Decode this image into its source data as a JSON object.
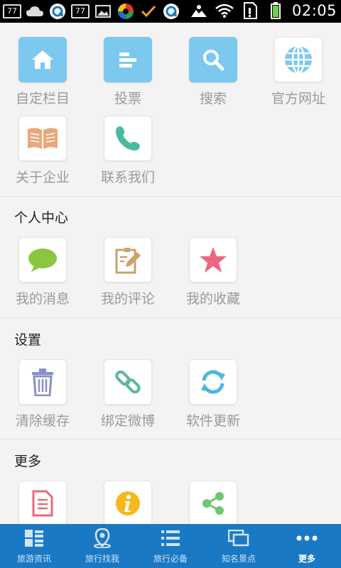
{
  "status_bar": {
    "left_badge_1": "77",
    "left_badge_2": "77",
    "time": "02:05",
    "icons": [
      "notification-number-icon",
      "cloud-icon",
      "q-app-icon",
      "notification-number-icon",
      "image-icon",
      "sync-app-icon",
      "checkmark-icon",
      "q-app-icon",
      "photo-icon",
      "wifi-icon",
      "sim-icon",
      "battery-icon"
    ]
  },
  "top_grid": [
    {
      "label": "自定栏目",
      "icon": "home-icon"
    },
    {
      "label": "投票",
      "icon": "bar-list-icon"
    },
    {
      "label": "搜索",
      "icon": "search-icon"
    },
    {
      "label": "官方网址",
      "icon": "globe-icon"
    },
    {
      "label": "关于企业",
      "icon": "book-icon"
    },
    {
      "label": "联系我们",
      "icon": "phone-icon"
    }
  ],
  "sections": {
    "personal": {
      "title": "个人中心",
      "items": [
        {
          "label": "我的消息",
          "icon": "chat-bubble-icon"
        },
        {
          "label": "我的评论",
          "icon": "edit-note-icon"
        },
        {
          "label": "我的收藏",
          "icon": "star-icon"
        }
      ]
    },
    "settings": {
      "title": "设置",
      "items": [
        {
          "label": "清除缓存",
          "icon": "trash-icon"
        },
        {
          "label": "绑定微博",
          "icon": "link-icon"
        },
        {
          "label": "软件更新",
          "icon": "refresh-icon"
        }
      ]
    },
    "more": {
      "title": "更多",
      "items": [
        {
          "label": "",
          "icon": "document-icon"
        },
        {
          "label": "",
          "icon": "info-icon"
        },
        {
          "label": "",
          "icon": "share-icon"
        }
      ]
    }
  },
  "tabs": [
    {
      "label": "旅游资讯",
      "icon": "grid-list-icon",
      "active": false
    },
    {
      "label": "旅行找我",
      "icon": "location-pin-icon",
      "active": false
    },
    {
      "label": "旅行必备",
      "icon": "list-icon",
      "active": false
    },
    {
      "label": "知名景点",
      "icon": "windows-icon",
      "active": false
    },
    {
      "label": "更多",
      "icon": "more-dots-icon",
      "active": true
    }
  ],
  "colors": {
    "tab_bar": "#1a79c4",
    "tile_blue": "#7cc8ef",
    "background": "#f3f3f3"
  }
}
